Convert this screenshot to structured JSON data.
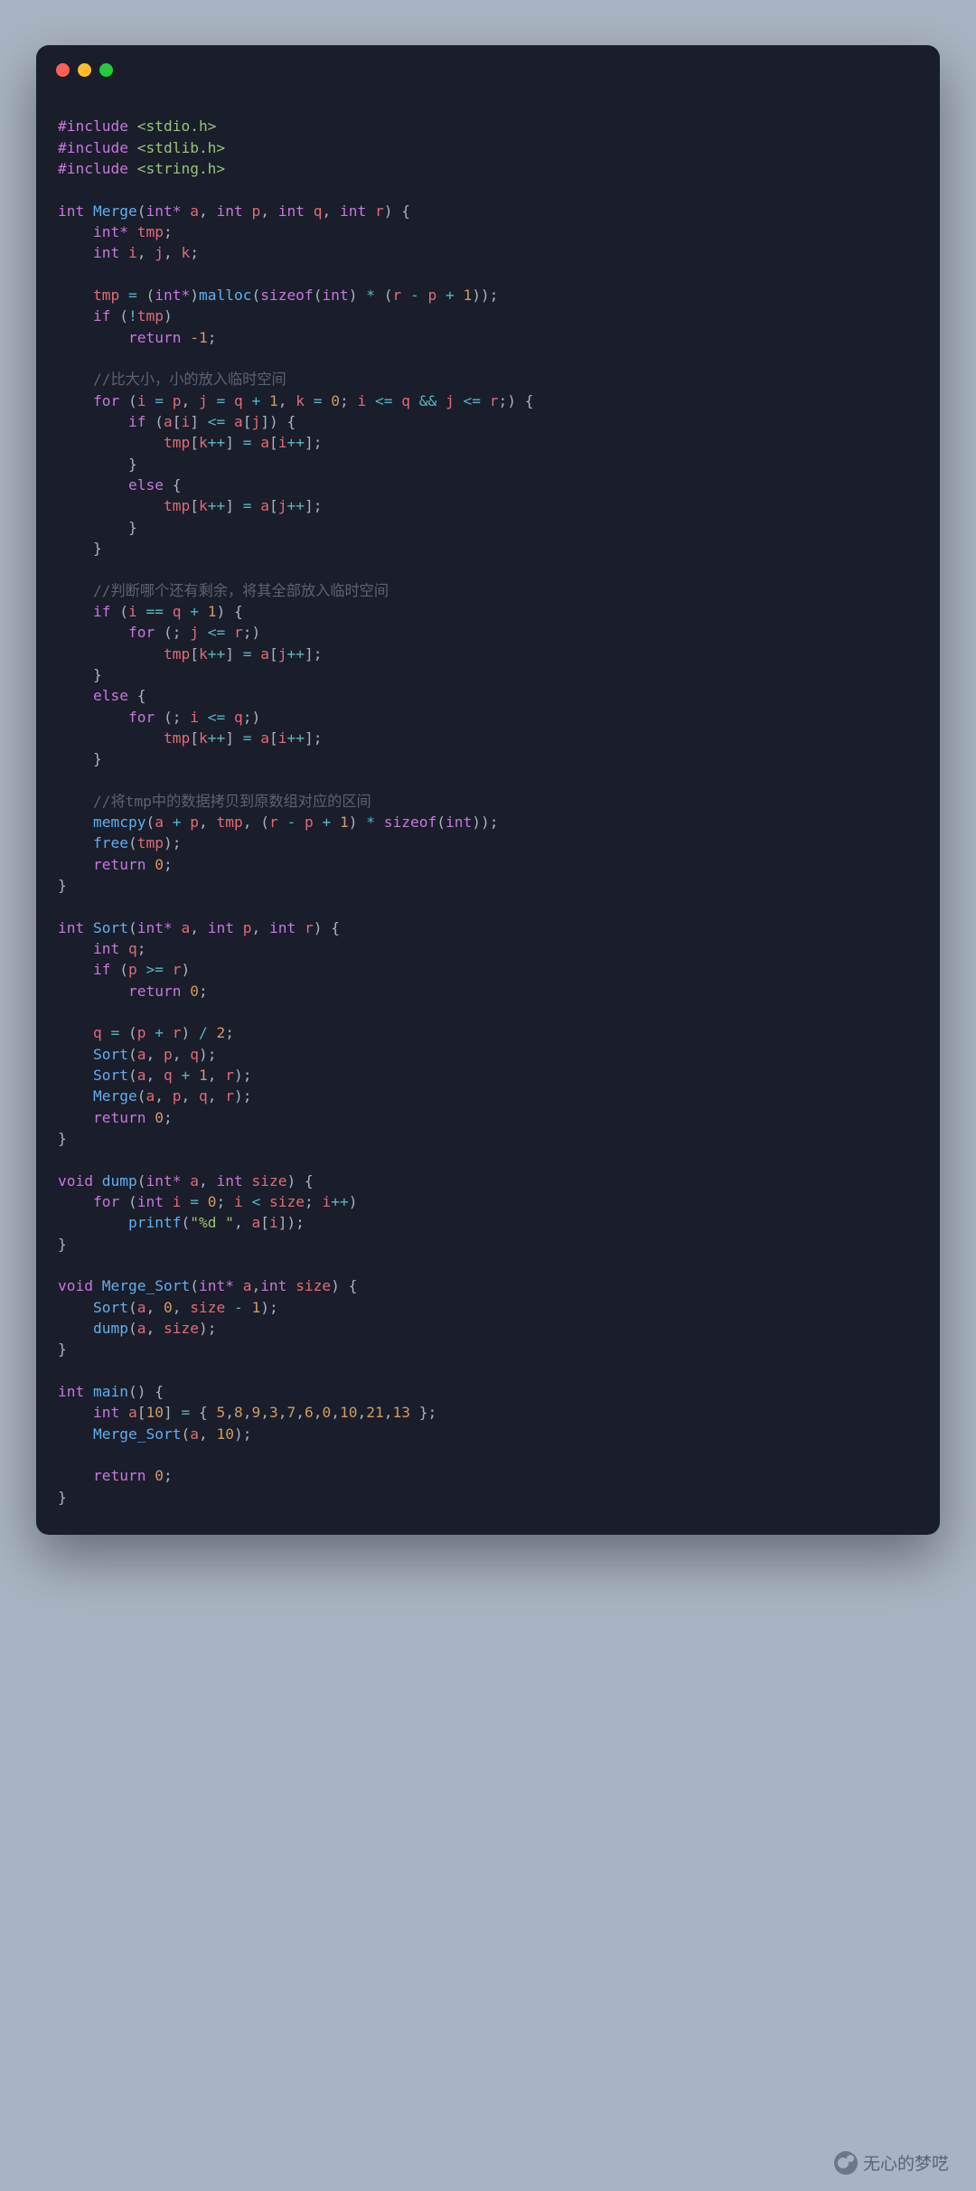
{
  "window": {
    "dots": {
      "red": "#ff5f56",
      "yellow": "#ffbd2e",
      "green": "#27c93f"
    }
  },
  "watermark": "无心的梦呓",
  "t": {
    "include": "#include",
    "hstdio": "<stdio.h>",
    "hstdlib": "<stdlib.h>",
    "hstring": "<string.h>",
    "int": "int",
    "intp": "int*",
    "void": "void",
    "Merge": "Merge",
    "Sort": "Sort",
    "dump": "dump",
    "Merge_Sort": "Merge_Sort",
    "main": "main",
    "a": "a",
    "p": "p",
    "q": "q",
    "r": "r",
    "i": "i",
    "j": "j",
    "k": "k",
    "tmp": "tmp",
    "size": "size",
    "if": "if",
    "else": "else",
    "for": "for",
    "return": "return",
    "malloc": "malloc",
    "sizeof": "sizeof",
    "memcpy": "memcpy",
    "free": "free",
    "printf": "printf",
    "n0": "0",
    "n1": "1",
    "n2": "2",
    "nm1": "-1",
    "n10": "10",
    "n5": "5",
    "n8": "8",
    "n9": "9",
    "n3": "3",
    "n7": "7",
    "n6": "6",
    "n21": "21",
    "n13": "13",
    "str_pd": "\"%d \"",
    "cm1": "//比大小，小的放入临时空间",
    "cm2": "//判断哪个还有剩余，将其全部放入临时空间",
    "cm3": "//将tmp中的数据拷贝到原数组对应的区间"
  }
}
